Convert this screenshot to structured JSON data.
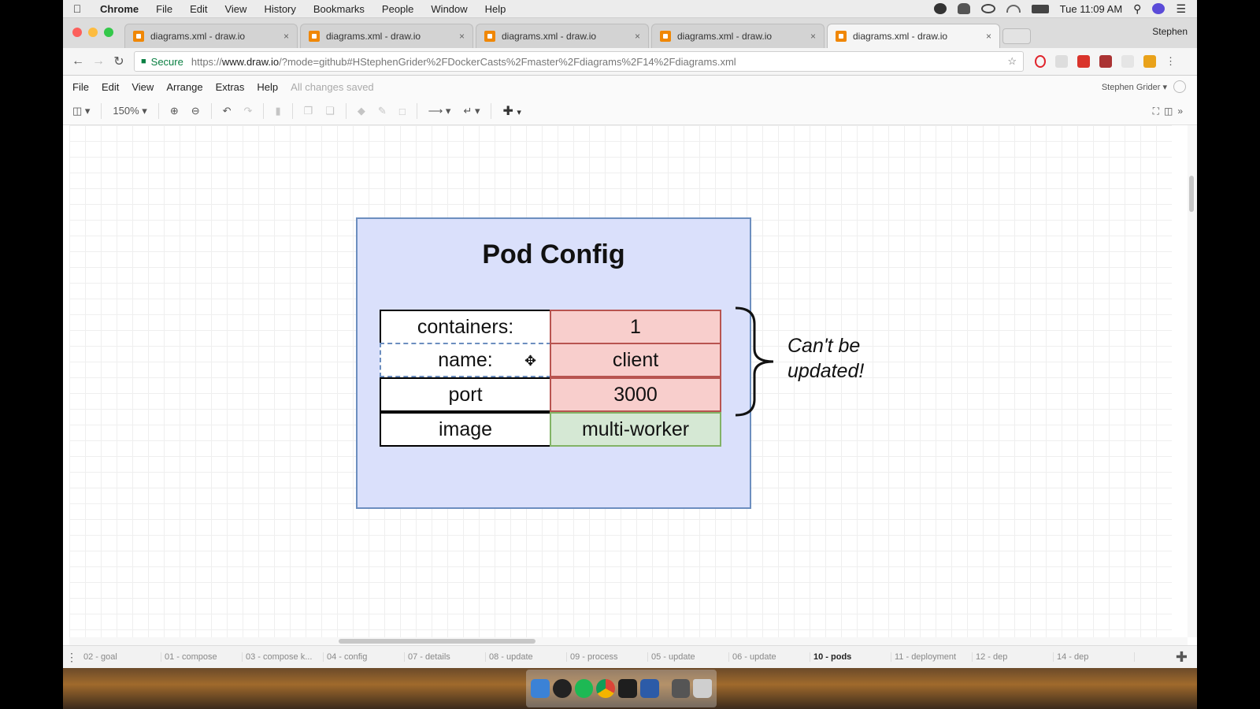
{
  "menubar": {
    "app": "Chrome",
    "items": [
      "File",
      "Edit",
      "View",
      "History",
      "Bookmarks",
      "People",
      "Window",
      "Help"
    ],
    "clock": "Tue 11:09 AM"
  },
  "tabs": [
    {
      "title": "diagrams.xml - draw.io",
      "close": "×"
    },
    {
      "title": "diagrams.xml - draw.io",
      "close": "×"
    },
    {
      "title": "diagrams.xml - draw.io",
      "close": "×"
    },
    {
      "title": "diagrams.xml - draw.io",
      "close": "×"
    },
    {
      "title": "diagrams.xml - draw.io",
      "close": "×"
    }
  ],
  "profile_name": "Stephen",
  "address": {
    "secure_label": "Secure",
    "url_prefix": "https://",
    "url_host": "www.draw.io",
    "url_rest": "/?mode=github#HStephenGrider%2FDockerCasts%2Fmaster%2Fdiagrams%2F14%2Fdiagrams.xml"
  },
  "drawio_menu": {
    "items": [
      "File",
      "Edit",
      "View",
      "Arrange",
      "Extras",
      "Help"
    ],
    "status": "All changes saved",
    "user": "Stephen Grider ▾"
  },
  "toolbar": {
    "zoom": "150%"
  },
  "diagram": {
    "title": "Pod Config",
    "rows": [
      {
        "key": "containers:",
        "value": "1",
        "status": "locked"
      },
      {
        "key": "name:",
        "value": "client",
        "status": "locked"
      },
      {
        "key": "port",
        "value": "3000",
        "status": "locked"
      },
      {
        "key": "image",
        "value": "multi-worker",
        "status": "editable"
      }
    ],
    "note_line1": "Can't be",
    "note_line2": "updated!",
    "colors": {
      "container_fill": "#dae0fb",
      "container_border": "#6c8ebf",
      "locked_fill": "#f8cecc",
      "locked_border": "#b85450",
      "editable_fill": "#d5e8d4",
      "editable_border": "#82b366"
    }
  },
  "pages": [
    {
      "label": "02 - goal"
    },
    {
      "label": "01 - compose"
    },
    {
      "label": "03 - compose k..."
    },
    {
      "label": "04 - config"
    },
    {
      "label": "07 - details"
    },
    {
      "label": "08 - update"
    },
    {
      "label": "09 - process"
    },
    {
      "label": "05 - update"
    },
    {
      "label": "06 - update"
    },
    {
      "label": "10 - pods",
      "active": true
    },
    {
      "label": "11 - deployment"
    },
    {
      "label": "12 - dep"
    },
    {
      "label": "14 - dep"
    }
  ]
}
